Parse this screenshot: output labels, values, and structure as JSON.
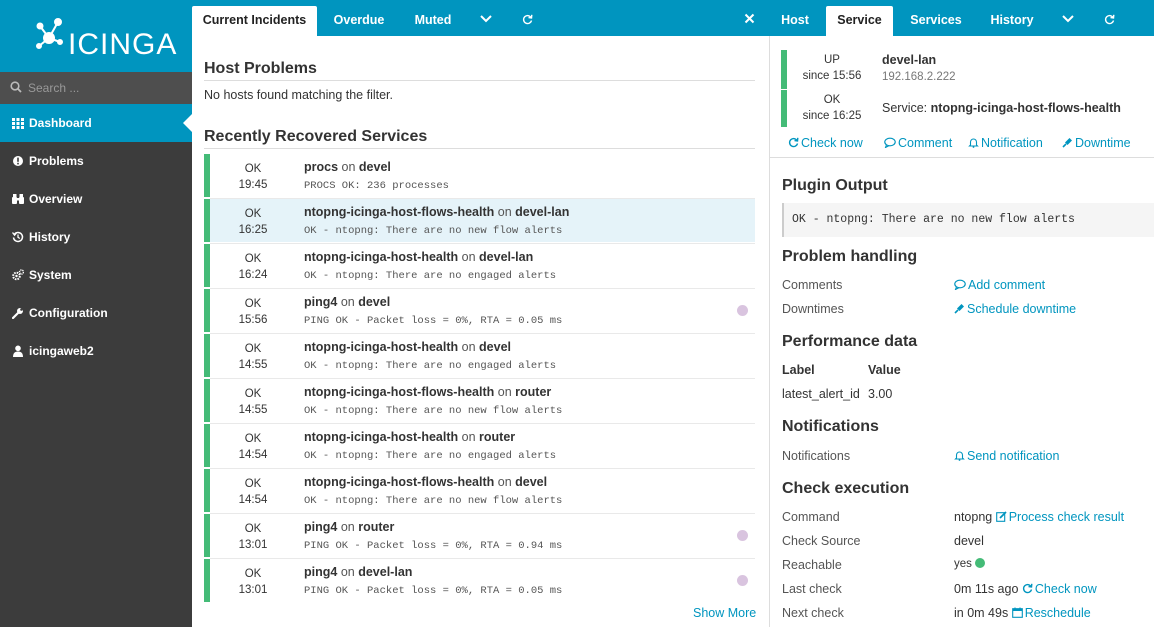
{
  "sidebar": {
    "logo_text": "ICINGA",
    "search_placeholder": "Search ...",
    "items": [
      {
        "label": "Dashboard",
        "icon": "dashboard-grid-icon",
        "active": true
      },
      {
        "label": "Problems",
        "icon": "alert-circle-icon"
      },
      {
        "label": "Overview",
        "icon": "binoculars-icon"
      },
      {
        "label": "History",
        "icon": "history-icon"
      },
      {
        "label": "System",
        "icon": "cogs-icon"
      },
      {
        "label": "Configuration",
        "icon": "wrench-icon"
      },
      {
        "label": "icingaweb2",
        "icon": "user-icon"
      }
    ]
  },
  "left_tabs": [
    "Current Incidents",
    "Overdue",
    "Muted"
  ],
  "right_tabs": [
    "Host",
    "Service",
    "Services",
    "History"
  ],
  "left": {
    "host_problems_title": "Host Problems",
    "host_problems_empty": "No hosts found matching the filter.",
    "recovered_title": "Recently Recovered Services",
    "show_more": "Show More",
    "rows": [
      {
        "state": "OK",
        "time": "19:45",
        "service": "procs",
        "on": "on",
        "host": "devel",
        "output": "PROCS OK: 236 processes",
        "dot": false,
        "selected": false
      },
      {
        "state": "OK",
        "time": "16:25",
        "service": "ntopng-icinga-host-flows-health",
        "on": "on",
        "host": "devel-lan",
        "output": "OK - ntopng: There are no new flow alerts",
        "dot": false,
        "selected": true
      },
      {
        "state": "OK",
        "time": "16:24",
        "service": "ntopng-icinga-host-health",
        "on": "on",
        "host": "devel-lan",
        "output": "OK - ntopng: There are no engaged alerts",
        "dot": false,
        "selected": false
      },
      {
        "state": "OK",
        "time": "15:56",
        "service": "ping4",
        "on": "on",
        "host": "devel",
        "output": "PING OK - Packet loss = 0%, RTA = 0.05 ms",
        "dot": true,
        "selected": false
      },
      {
        "state": "OK",
        "time": "14:55",
        "service": "ntopng-icinga-host-health",
        "on": "on",
        "host": "devel",
        "output": "OK - ntopng: There are no engaged alerts",
        "dot": false,
        "selected": false
      },
      {
        "state": "OK",
        "time": "14:55",
        "service": "ntopng-icinga-host-flows-health",
        "on": "on",
        "host": "router",
        "output": "OK - ntopng: There are no new flow alerts",
        "dot": false,
        "selected": false
      },
      {
        "state": "OK",
        "time": "14:54",
        "service": "ntopng-icinga-host-health",
        "on": "on",
        "host": "router",
        "output": "OK - ntopng: There are no engaged alerts",
        "dot": false,
        "selected": false
      },
      {
        "state": "OK",
        "time": "14:54",
        "service": "ntopng-icinga-host-flows-health",
        "on": "on",
        "host": "devel",
        "output": "OK - ntopng: There are no new flow alerts",
        "dot": false,
        "selected": false
      },
      {
        "state": "OK",
        "time": "13:01",
        "service": "ping4",
        "on": "on",
        "host": "router",
        "output": "PING OK - Packet loss = 0%, RTA = 0.94 ms",
        "dot": true,
        "selected": false
      },
      {
        "state": "OK",
        "time": "13:01",
        "service": "ping4",
        "on": "on",
        "host": "devel-lan",
        "output": "PING OK - Packet loss = 0%, RTA = 0.05 ms",
        "dot": true,
        "selected": false
      }
    ]
  },
  "right": {
    "host_state": "UP",
    "host_since": "since 15:56",
    "host_name": "devel-lan",
    "host_ip": "192.168.2.222",
    "service_state": "OK",
    "service_since": "since 16:25",
    "service_prefix": "Service:",
    "service_name": "ntopng-icinga-host-flows-health",
    "actions": {
      "check_now": "Check now",
      "comment": "Comment",
      "notification": "Notification",
      "downtime": "Downtime"
    },
    "plugin_output_title": "Plugin Output",
    "plugin_output": "OK - ntopng: There are no new flow alerts",
    "problem_handling_title": "Problem handling",
    "comments_label": "Comments",
    "add_comment": "Add comment",
    "downtimes_label": "Downtimes",
    "schedule_downtime": "Schedule downtime",
    "perfdata_title": "Performance data",
    "perf_label_header": "Label",
    "perf_value_header": "Value",
    "perf_label": "latest_alert_id",
    "perf_value": "3.00",
    "notifications_title": "Notifications",
    "notifications_label": "Notifications",
    "send_notification": "Send notification",
    "check_exec_title": "Check execution",
    "command_label": "Command",
    "command_value": "ntopng",
    "process_check_result": "Process check result",
    "check_source_label": "Check Source",
    "check_source_value": "devel",
    "reachable_label": "Reachable",
    "reachable_value": "yes",
    "last_check_label": "Last check",
    "last_check_value": "0m 11s ago",
    "last_check_action": "Check now",
    "next_check_label": "Next check",
    "next_check_value": "in 0m 49s",
    "reschedule": "Reschedule"
  },
  "colors": {
    "brand": "#0095bf",
    "ok": "#44bb77",
    "sidebar": "#3c3c3c"
  }
}
